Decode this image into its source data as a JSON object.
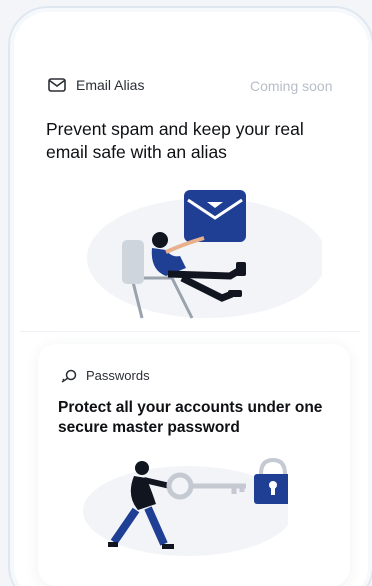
{
  "email_alias_card": {
    "label": "Email Alias",
    "badge": "Coming soon",
    "title": "Prevent spam and keep your real email safe with an alias",
    "icon": "envelope-icon"
  },
  "passwords_card": {
    "label": "Passwords",
    "title": "Protect all your accounts under one secure master password",
    "icon": "key-icon"
  },
  "colors": {
    "accent_blue": "#1f3f95",
    "muted_text": "#b8bec7",
    "dark_text": "#0e1014"
  }
}
